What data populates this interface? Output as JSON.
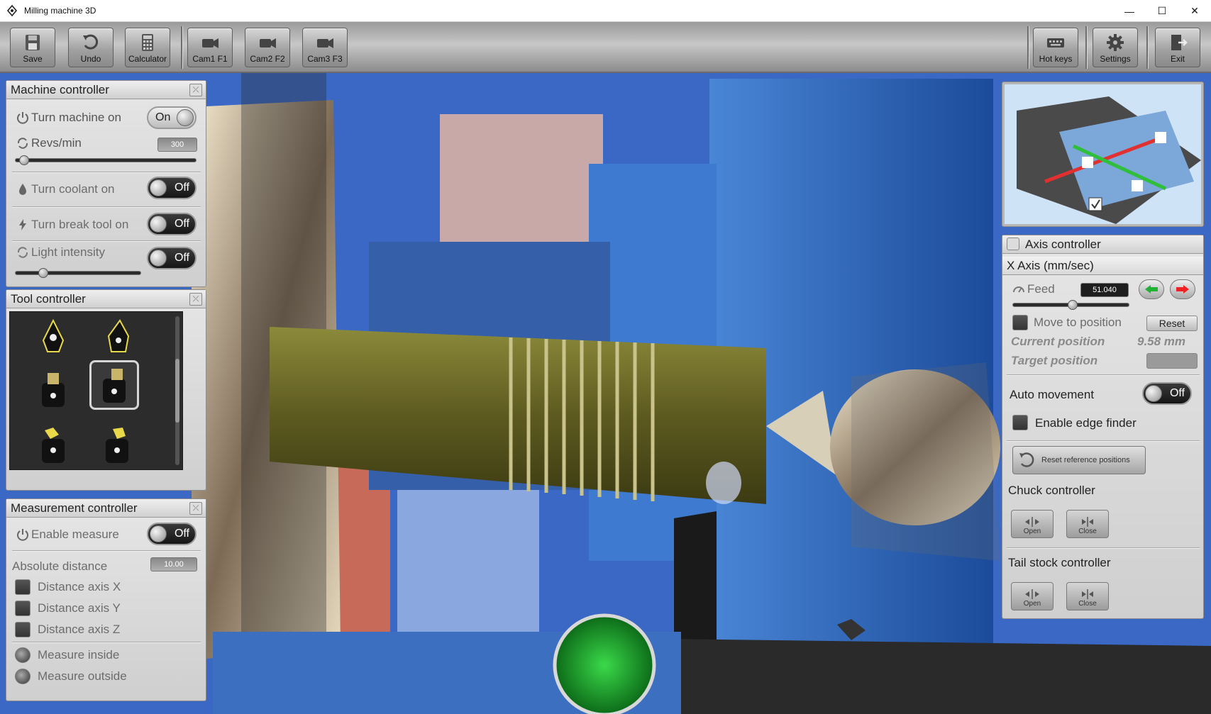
{
  "window": {
    "title": "Milling machine 3D",
    "minimize": "—",
    "maximize": "☐",
    "close": "✕"
  },
  "toolbar": {
    "left": [
      {
        "label": "Save",
        "icon": "floppy-icon"
      },
      {
        "label": "Undo",
        "icon": "undo-icon"
      },
      {
        "label": "Calculator",
        "icon": "calculator-icon"
      },
      {
        "label": "Cam1 F1",
        "icon": "camera-icon"
      },
      {
        "label": "Cam2 F2",
        "icon": "camera-icon"
      },
      {
        "label": "Cam3 F3",
        "icon": "camera-icon"
      }
    ],
    "right": [
      {
        "label": "Hot keys",
        "icon": "keyboard-icon"
      },
      {
        "label": "Settings",
        "icon": "gear-icon"
      },
      {
        "label": "Exit",
        "icon": "exit-icon"
      }
    ]
  },
  "machine_controller": {
    "title": "Machine controller",
    "turn_machine_label": "Turn machine on",
    "turn_machine_state": "On",
    "revs_label": "Revs/min",
    "revs_value": "300",
    "coolant_label": "Turn coolant on",
    "coolant_state": "Off",
    "break_tool_label": "Turn break tool on",
    "break_tool_state": "Off",
    "light_label": "Light intensity",
    "light_state": "Off"
  },
  "tool_controller": {
    "title": "Tool controller"
  },
  "measurement_controller": {
    "title": "Measurement controller",
    "enable_label": "Enable measure",
    "enable_state": "Off",
    "absolute_label": "Absolute distance",
    "absolute_value": "10.00",
    "axis_x": "Distance axis X",
    "axis_y": "Distance axis Y",
    "axis_z": "Distance axis Z",
    "inside": "Measure inside",
    "outside": "Measure outside"
  },
  "axis_controller": {
    "title": "Axis controller",
    "axis_title": "X Axis (mm/sec)",
    "feed_label": "Feed",
    "feed_value": "51.040",
    "move_label": "Move to position",
    "reset_label": "Reset",
    "current_label": "Current position",
    "current_value": "9.58 mm",
    "target_label": "Target position",
    "auto_label": "Auto movement",
    "auto_state": "Off",
    "edge_label": "Enable edge finder",
    "reset_ref_label": "Reset reference positions",
    "chuck_title": "Chuck controller",
    "chuck_open": "Open",
    "chuck_close": "Close",
    "tail_title": "Tail stock controller",
    "tail_open": "Open",
    "tail_close": "Close"
  },
  "colors": {
    "toolbar": "#b5b5b5",
    "panel": "#dcdcdc",
    "scene_blue": "#2d5cc0",
    "workpiece": "#6b6a28"
  }
}
